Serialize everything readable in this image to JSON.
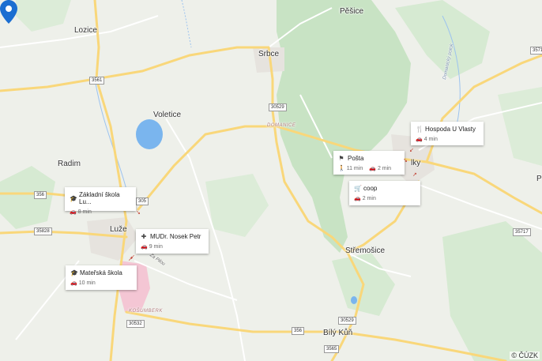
{
  "places": {
    "pesice": "Pěšice",
    "lozice": "Lozice",
    "srbce": "Srbce",
    "voletice": "Voletice",
    "domanice": "DOMANICE",
    "radim": "Radim",
    "luze": "Luže",
    "stremosice": "Střemošice",
    "bily_kun": "Bílý Kůň",
    "kosumberk": "KOŠUMBERK",
    "za_pilou": "Za Pilou",
    "lky": "lky",
    "p_edge": "P",
    "domanicky_potok": "Domanický potok"
  },
  "road_shields": {
    "r3561": "3561",
    "r30529_top": "30529",
    "r356_left": "356",
    "r35828": "35828",
    "r305": "305",
    "r30532": "30532",
    "r356_bottom": "356",
    "r30529_bottom": "30529",
    "r3565": "3565",
    "r35717": "35717",
    "r3571": "3571"
  },
  "poi_cards": [
    {
      "title": "Hospoda U Vlasty",
      "icon": "restaurant-icon",
      "car": "4 min"
    },
    {
      "title": "Pošta",
      "icon": "post-office-icon",
      "walk": "11 min",
      "car": "2 min"
    },
    {
      "title": "coop",
      "icon": "shopping-cart-icon",
      "car": "2 min"
    },
    {
      "title": "Základní škola Lu...",
      "icon": "school-icon",
      "car": "8 min"
    },
    {
      "title": "MUDr. Nosek Petr",
      "icon": "medical-icon",
      "car": "9 min"
    },
    {
      "title": "Mateřská škola",
      "icon": "school-icon",
      "car": "10 min"
    }
  ],
  "copyright": "© ČÚZK",
  "colors": {
    "land": "#eef0ea",
    "forest": "#c8e3c4",
    "water": "#7ab5ee",
    "road_major": "#f9d77a",
    "road_minor": "#ffffff",
    "pin": "#1b6ed1",
    "urban": "#f4c6d4"
  }
}
